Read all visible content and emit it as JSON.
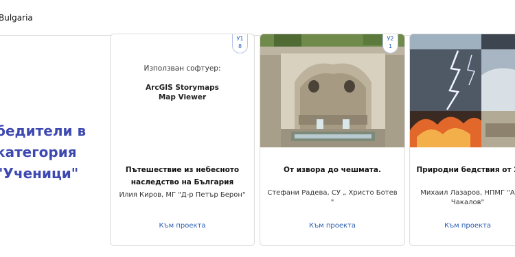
{
  "header": {
    "title": "Bulgaria"
  },
  "section": {
    "heading_lines": [
      "бедители в",
      "категория",
      "\"Ученици\""
    ]
  },
  "cards": [
    {
      "badge_lines": [
        "У1",
        "8"
      ],
      "software_label": "Използван софтуер:",
      "software_lines": [
        "ArcGIS Storymaps",
        "Map Viewer"
      ],
      "title_lines": [
        "Пътешествие из небесното",
        "наследство на България"
      ],
      "author_lines": [
        "Илия Киров, МГ \"Д-р Петър Берон\""
      ],
      "link": "Към проекта"
    },
    {
      "badge_lines": [
        "У2",
        "1"
      ],
      "image_icon": "stone-fountain-photo",
      "title_lines": [
        "От извора до чешмата."
      ],
      "author_lines": [
        "Стефани Радева, СУ „ Христо Ботев",
        "\""
      ],
      "link": "Към проекта"
    },
    {
      "image_icon": "natural-disasters-collage-photo",
      "title_lines": [
        "Природни бедствия от 2"
      ],
      "author_lines": [
        "Михаил Лазаров, НПМГ \"А",
        "Чакалов\""
      ],
      "link": "Към проекта"
    }
  ]
}
